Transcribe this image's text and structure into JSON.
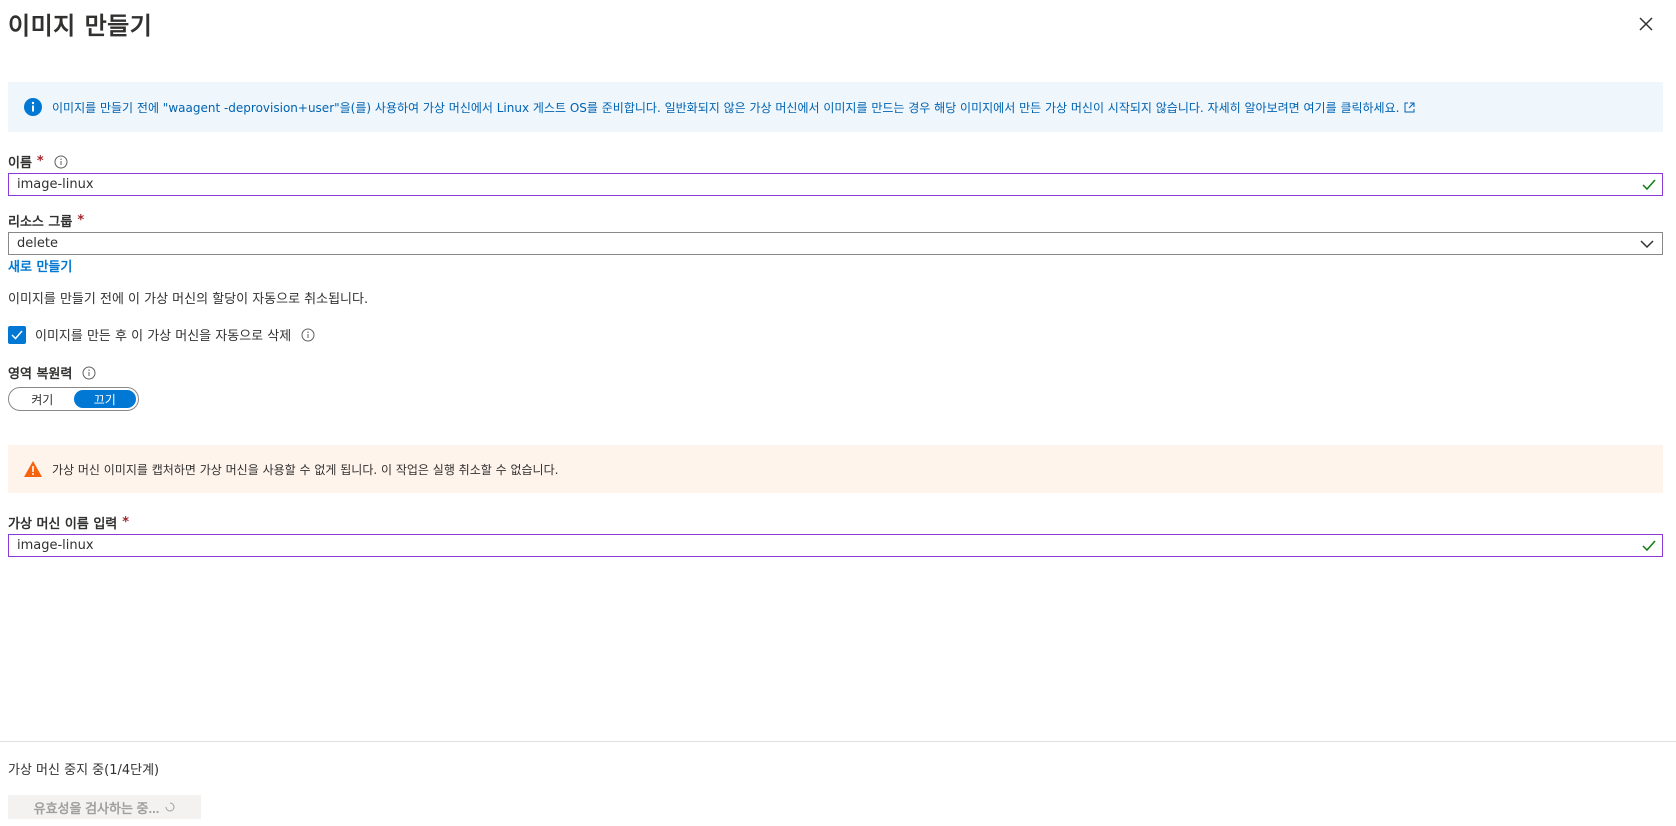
{
  "header": {
    "title": "이미지 만들기"
  },
  "info_bar": {
    "message": "이미지를 만들기 전에 \"waagent -deprovision+user\"을(를) 사용하여 가상 머신에서 Linux 게스트 OS를 준비합니다. 일반화되지 않은 가상 머신에서 이미지를 만드는 경우 해당 이미지에서 만든 가상 머신이 시작되지 않습니다. 자세히 알아보려면 여기를 클릭하세요."
  },
  "form": {
    "name_label": "이름",
    "name_value": "image-linux",
    "resource_group_label": "리소스 그룹",
    "resource_group_value": "delete",
    "create_new_link": "새로 만들기",
    "dealloc_note": "이미지를 만들기 전에 이 가상 머신의 할당이 자동으로 취소됩니다.",
    "auto_delete_label": "이미지를 만든 후 이 가상 머신을 자동으로 삭제",
    "auto_delete_checked": true,
    "zone_resiliency_label": "영역 복원력",
    "toggle_on": "켜기",
    "toggle_off": "끄기",
    "toggle_selected": "끄기",
    "required_mark": "*"
  },
  "warning_bar": {
    "message": "가상 머신 이미지를 캡처하면 가상 머신을 사용할 수 없게 됩니다. 이 작업은 실행 취소할 수 없습니다."
  },
  "confirm": {
    "label": "가상 머신 이름 입력",
    "value": "image-linux"
  },
  "footer": {
    "status": "가상 머신 중지 중(1/4단계)",
    "validate_button": "유효성을 검사하는 중..."
  },
  "colors": {
    "accent": "#0078d4",
    "focus_border": "#8a3ad6",
    "valid_check": "#107c10",
    "required": "#a4262c",
    "info_bg": "#eff6fc",
    "warn_bg": "#fff4ec",
    "warn_icon": "#f7630c"
  }
}
